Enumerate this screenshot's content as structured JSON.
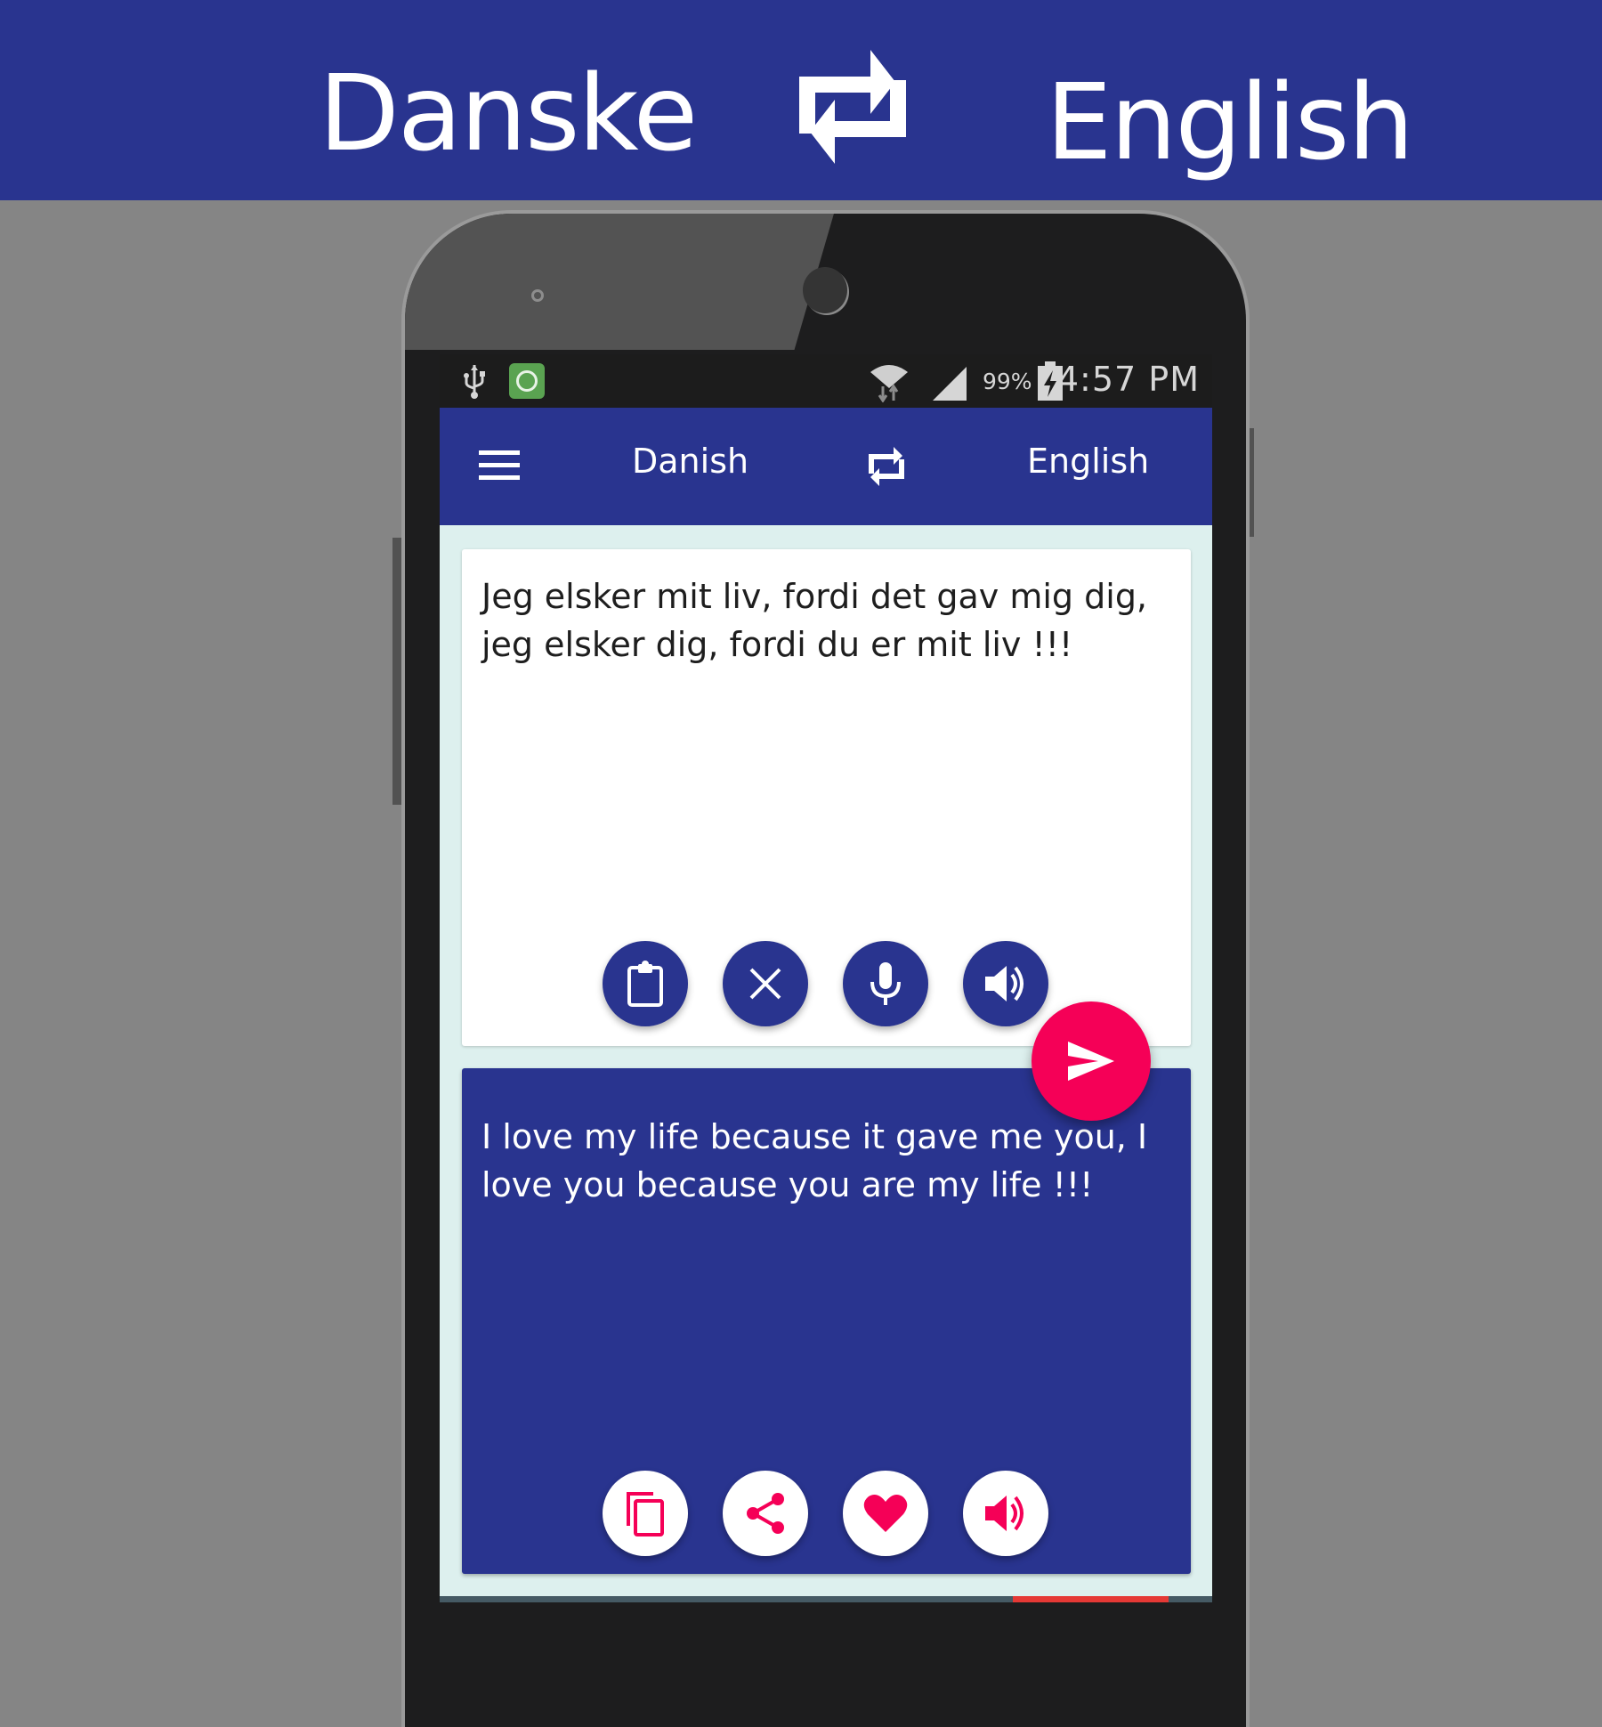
{
  "banner": {
    "source_language": "Danske",
    "target_language": "English",
    "swap_icon": "swap-arrows-icon"
  },
  "status_bar": {
    "left_icons": [
      "usb-icon",
      "app-notification-icon"
    ],
    "right_icons": [
      "wifi-icon",
      "signal-icon",
      "battery-charging-icon"
    ],
    "battery_percent": "99%",
    "time": "4:57 PM"
  },
  "app_bar": {
    "menu_icon": "hamburger-menu-icon",
    "source_language": "Danish",
    "swap_icon": "swap-arrows-icon",
    "target_language": "English"
  },
  "input": {
    "text": "Jeg elsker mit liv, fordi det gav mig dig, jeg elsker dig, fordi du er mit liv !!!",
    "actions": [
      {
        "name": "paste",
        "icon": "clipboard-icon"
      },
      {
        "name": "clear",
        "icon": "close-icon"
      },
      {
        "name": "voice-input",
        "icon": "microphone-icon"
      },
      {
        "name": "speak",
        "icon": "speaker-icon"
      }
    ]
  },
  "translate_button": {
    "icon": "send-icon"
  },
  "output": {
    "text": "I love my life because it gave me you, I love you because you are my life !!!",
    "actions": [
      {
        "name": "copy",
        "icon": "copy-icon"
      },
      {
        "name": "share",
        "icon": "share-icon"
      },
      {
        "name": "favorite",
        "icon": "heart-icon"
      },
      {
        "name": "speak",
        "icon": "speaker-icon"
      }
    ]
  },
  "colors": {
    "primary": "#29348f",
    "accent": "#f50057",
    "background": "#ddf0ee",
    "page_background": "#858585"
  }
}
